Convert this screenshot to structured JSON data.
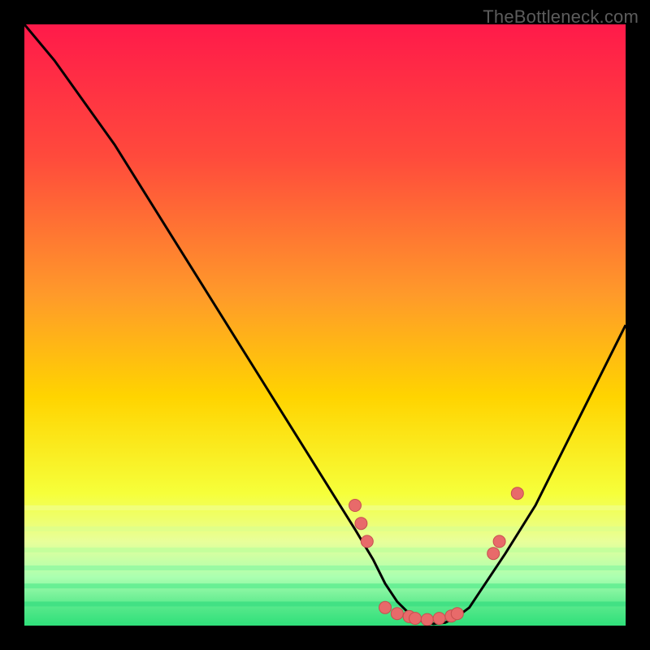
{
  "watermark": "TheBottleneck.com",
  "colors": {
    "gradient_top": "#ff1a4a",
    "gradient_mid": "#ffd400",
    "gradient_green_light": "#e8ff9a",
    "gradient_green": "#2fe07a",
    "line": "#000000",
    "dot_fill": "#e86a6a",
    "dot_stroke": "#c74f4f",
    "frame": "#000000"
  },
  "chart_data": {
    "type": "line",
    "title": "",
    "xlabel": "",
    "ylabel": "",
    "xlim": [
      0,
      100
    ],
    "ylim": [
      0,
      100
    ],
    "series": [
      {
        "name": "curve",
        "x": [
          0,
          5,
          10,
          15,
          20,
          25,
          30,
          35,
          40,
          45,
          50,
          55,
          58,
          60,
          62,
          64,
          66,
          68,
          70,
          72,
          74,
          76,
          80,
          85,
          90,
          95,
          100
        ],
        "y": [
          100,
          94,
          87,
          80,
          72,
          64,
          56,
          48,
          40,
          32,
          24,
          16,
          11,
          7,
          4,
          2,
          0.8,
          0.3,
          0.5,
          1.5,
          3,
          6,
          12,
          20,
          30,
          40,
          50
        ]
      }
    ],
    "marker_points": [
      {
        "x": 55,
        "y": 20
      },
      {
        "x": 56,
        "y": 17
      },
      {
        "x": 57,
        "y": 14
      },
      {
        "x": 60,
        "y": 3
      },
      {
        "x": 62,
        "y": 2
      },
      {
        "x": 64,
        "y": 1.5
      },
      {
        "x": 65,
        "y": 1.2
      },
      {
        "x": 67,
        "y": 1
      },
      {
        "x": 69,
        "y": 1.2
      },
      {
        "x": 71,
        "y": 1.6
      },
      {
        "x": 72,
        "y": 2
      },
      {
        "x": 78,
        "y": 12
      },
      {
        "x": 79,
        "y": 14
      },
      {
        "x": 82,
        "y": 22
      }
    ]
  }
}
